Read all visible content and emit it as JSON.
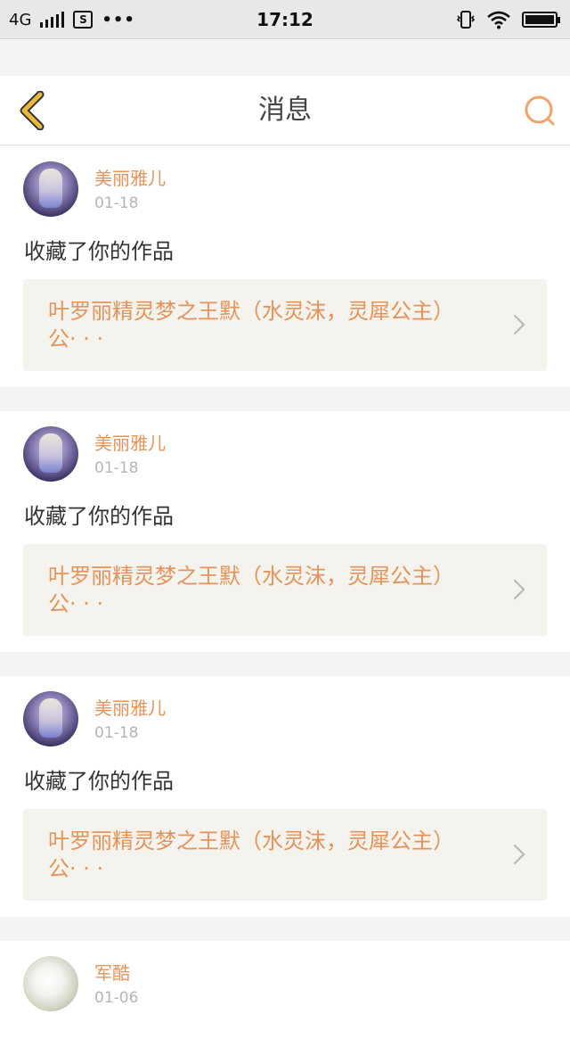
{
  "status_bar": {
    "network": "4G",
    "time": "17:12",
    "sim_label": "S",
    "more": "•••"
  },
  "header": {
    "title": "消息",
    "back_icon": "chevron-left-icon",
    "search_icon": "search-icon"
  },
  "colors": {
    "accent": "#e6935a",
    "back_icon": "#e8b93a",
    "search_icon": "#f0a36a"
  },
  "messages": [
    {
      "user": "美丽雅儿",
      "date": "01-18",
      "action": "收藏了你的作品",
      "work_title": "叶罗丽精灵梦之王默（水灵沫，灵犀公主）公· · ·"
    },
    {
      "user": "美丽雅儿",
      "date": "01-18",
      "action": "收藏了你的作品",
      "work_title": "叶罗丽精灵梦之王默（水灵沫，灵犀公主）公· · ·"
    },
    {
      "user": "美丽雅儿",
      "date": "01-18",
      "action": "收藏了你的作品",
      "work_title": "叶罗丽精灵梦之王默（水灵沫，灵犀公主）公· · ·"
    },
    {
      "user": "军酷",
      "date": "01-06"
    }
  ]
}
